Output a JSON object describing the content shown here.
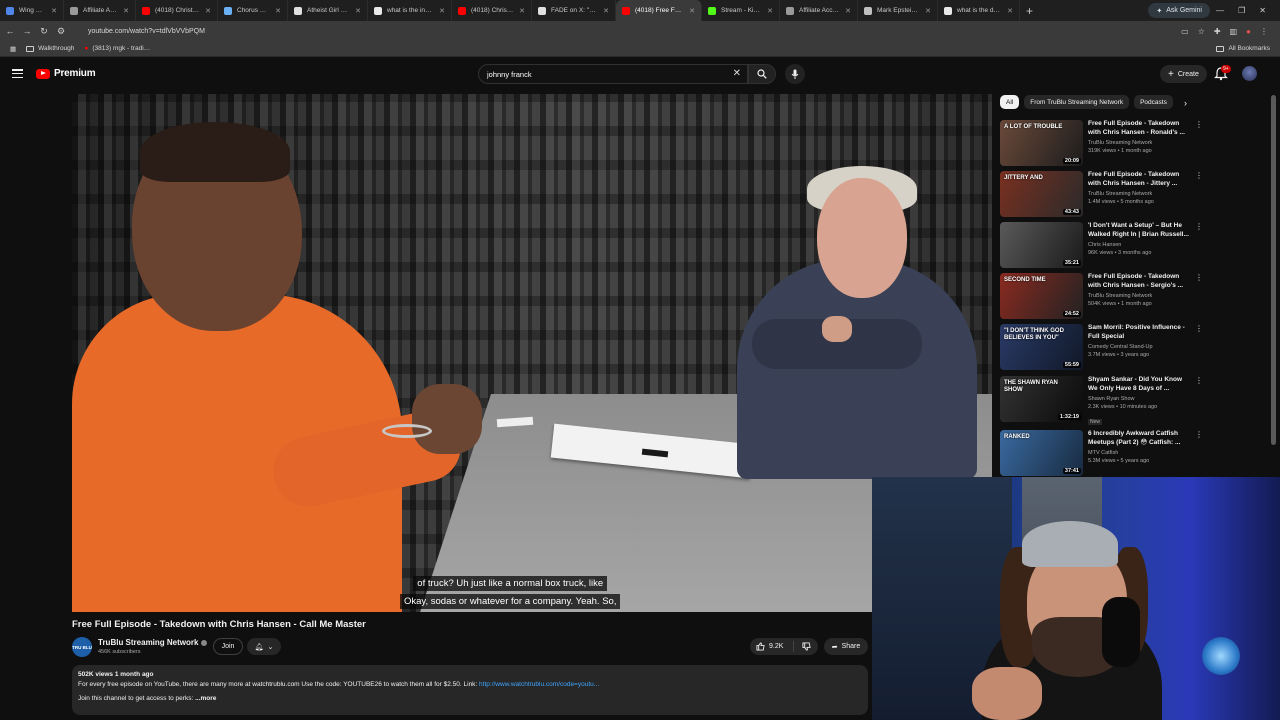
{
  "browser": {
    "tabs": [
      {
        "title": "Wing Strikes Pala…",
        "color": "#4f86e8"
      },
      {
        "title": "Affiliate Account",
        "color": "#9a9a9a"
      },
      {
        "title": "(4018) Christian v…",
        "color": "#ff0000"
      },
      {
        "title": "Chorus Encore",
        "color": "#6ab0f3"
      },
      {
        "title": "Atheist Girl on X…",
        "color": "#e0e0e0"
      },
      {
        "title": "what is the inbre…",
        "color": "#e8e8e8"
      },
      {
        "title": "(4018) Christians…",
        "color": "#ff0000"
      },
      {
        "title": "FADE on X: \"Bud…",
        "color": "#e0e0e0"
      },
      {
        "title": "(4018) Free Fu…",
        "color": "#ff0000",
        "active": true
      },
      {
        "title": "Stream - Kick Das…",
        "color": "#53fc18"
      },
      {
        "title": "Affiliate Account",
        "color": "#9a9a9a"
      },
      {
        "title": "Mark Epstein — L…",
        "color": "#c0c0c0"
      },
      {
        "title": "what is the doctrin…",
        "color": "#e8e8e8"
      }
    ],
    "ask_gemini": "Ask Gemini",
    "url": "youtube.com/watch?v=tdlVbVVbPQM",
    "bookmarks": [
      "Walkthrough",
      "(3813) mgk - tradi…"
    ],
    "all_bookmarks": "All Bookmarks"
  },
  "header": {
    "logo_text": "Premium",
    "search_value": "johnny franck",
    "create_label": "Create",
    "notif_badge": "9+"
  },
  "video": {
    "caption_line1": "of truck? Uh just like a normal box truck, like",
    "caption_line2": "Okay, sodas or whatever for a company. Yeah. So,",
    "title": "Free Full Episode - Takedown with Chris Hansen - Call Me Master"
  },
  "channel": {
    "avatar_text": "TRU BLU",
    "name": "TruBlu Streaming Network",
    "subscribers": "456K subscribers",
    "join_label": "Join"
  },
  "actions": {
    "likes": "9.2K",
    "share_label": "Share"
  },
  "description": {
    "meta": "502K views  1 month ago",
    "line1": "For every free episode on YouTube, there are many more at watchtrublu.com  Use the code: YOUTUBE26 to watch them all for $2.50.  Link: ",
    "link": "http://www.watchtrublu.com/code=youtu...",
    "line2": "Join this channel to get access to perks: ",
    "more": "...more"
  },
  "sidebar": {
    "chips": [
      "All",
      "From TruBlu Streaming Network",
      "Podcasts"
    ],
    "items": [
      {
        "title": "Free Full Episode - Takedown with Chris Hansen - Ronald's ...",
        "channel": "TruBlu Streaming Network",
        "meta": "319K views • 1 month ago",
        "duration": "20:09",
        "thumb": "A LOT OF TROUBLE",
        "c1": "#6b4a3a",
        "c2": "#1c1c1c"
      },
      {
        "title": "Free Full Episode - Takedown with Chris Hansen - Jittery ...",
        "channel": "TruBlu Streaming Network",
        "meta": "1.4M views • 5 months ago",
        "duration": "43:43",
        "thumb": "JITTERY AND",
        "c1": "#7a3020",
        "c2": "#2a2a2a"
      },
      {
        "title": "'I Don't Want a Setup' – But He Walked Right In | Brian Russell...",
        "channel": "Chris Hansen",
        "meta": "96K views • 3 months ago",
        "duration": "35:21",
        "thumb": "",
        "c1": "#5a5a5a",
        "c2": "#1a1a1a"
      },
      {
        "title": "Free Full Episode - Takedown with Chris Hansen - Sergio's ...",
        "channel": "TruBlu Streaming Network",
        "meta": "504K views • 1 month ago",
        "duration": "24:52",
        "thumb": "SECOND TIME",
        "c1": "#8a2a20",
        "c2": "#222"
      },
      {
        "title": "Sam Morril: Positive Influence - Full Special",
        "channel": "Comedy Central Stand-Up",
        "meta": "3.7M views • 3 years ago",
        "duration": "55:59",
        "thumb": "\"I DON'T THINK GOD BELIEVES IN YOU\"",
        "c1": "#2a3a66",
        "c2": "#101828"
      },
      {
        "title": "Shyam Sankar - Did You Know We Only Have 8 Days of ...",
        "channel": "Shawn Ryan Show",
        "meta": "2.3K views • 10 minutes ago",
        "duration": "1:32:19",
        "thumb": "THE SHAWN RYAN SHOW",
        "c1": "#333",
        "c2": "#0a0a0a",
        "badge": "New"
      },
      {
        "title": "6 Incredibly Awkward Catfish Meetups (Part 2) 😳 Catfish: ...",
        "channel": "MTV Catfish",
        "meta": "5.3M views • 5 years ago",
        "duration": "37:41",
        "thumb": "RANKED",
        "c1": "#3a6aa0",
        "c2": "#182a40"
      }
    ]
  },
  "colors": {
    "youtube_red": "#ff0000",
    "link_blue": "#3ea6ff",
    "background": "#0f0f0f"
  }
}
